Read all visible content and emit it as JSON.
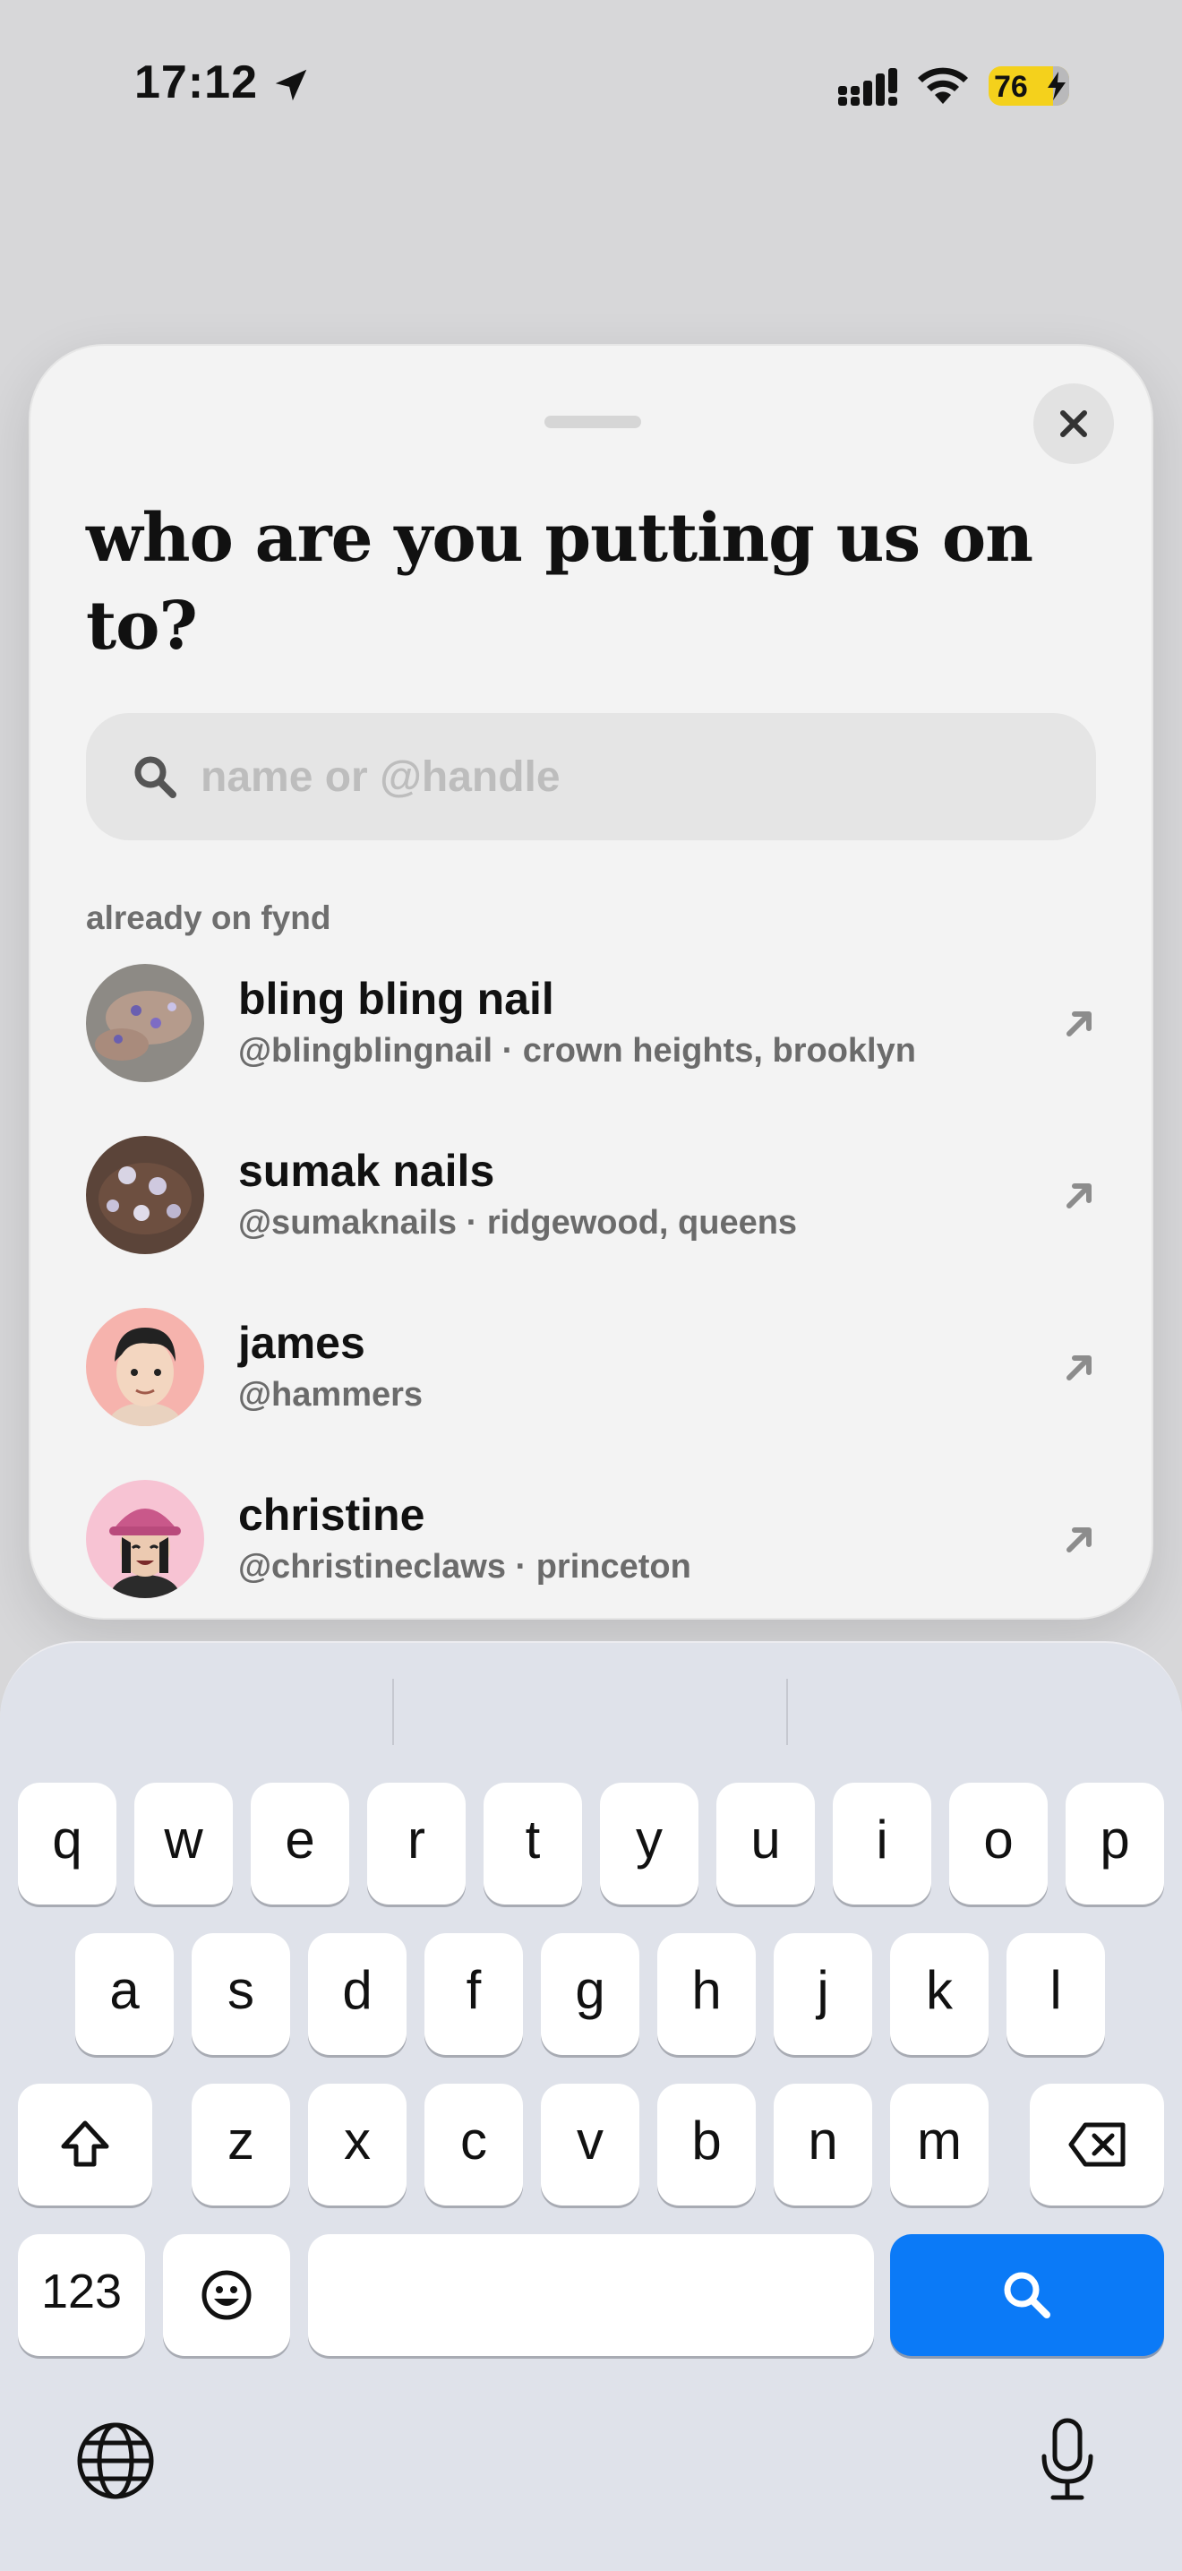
{
  "status_bar": {
    "time": "17:12",
    "battery": "76"
  },
  "sheet": {
    "title": "who are you putting us on to?",
    "search": {
      "placeholder": "name or @handle",
      "value": ""
    },
    "section_label": "already on fynd",
    "people": [
      {
        "name": "bling bling nail",
        "subtitle": "@blingblingnail · crown heights, brooklyn"
      },
      {
        "name": "sumak nails",
        "subtitle": "@sumaknails · ridgewood, queens"
      },
      {
        "name": "james",
        "subtitle": "@hammers"
      },
      {
        "name": "christine",
        "subtitle": "@christineclaws · princeton"
      }
    ]
  },
  "keyboard": {
    "row1": [
      "q",
      "w",
      "e",
      "r",
      "t",
      "y",
      "u",
      "i",
      "o",
      "p"
    ],
    "row2": [
      "a",
      "s",
      "d",
      "f",
      "g",
      "h",
      "j",
      "k",
      "l"
    ],
    "row3": [
      "z",
      "x",
      "c",
      "v",
      "b",
      "n",
      "m"
    ],
    "numbers_label": "123",
    "accent_color": "#0b7af7"
  }
}
